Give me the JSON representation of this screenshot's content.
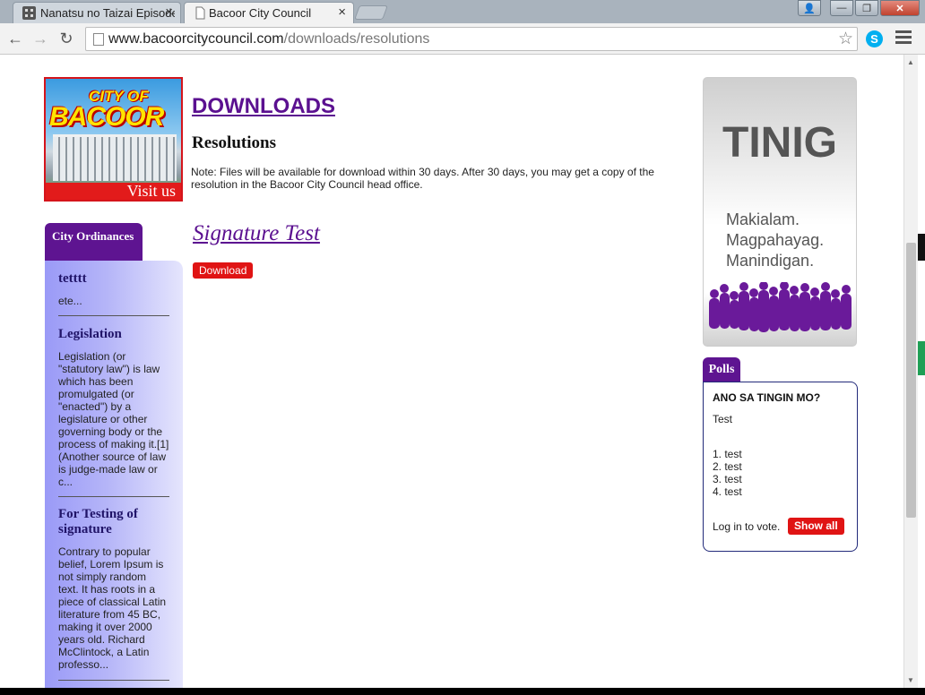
{
  "browser": {
    "tabs": [
      {
        "title": "Nanatsu no Taizai Episode",
        "close": "×"
      },
      {
        "title": "Bacoor City Council",
        "close": "×"
      }
    ],
    "url_host": "www.bacoorcitycouncil.com",
    "url_path": "/downloads/resolutions",
    "nav": {
      "back": "←",
      "forward": "→",
      "reload": "↻"
    },
    "star": "☆",
    "skype": "S",
    "window": {
      "minimize": "—",
      "maximize": "❐",
      "close": "✕",
      "user": "👤"
    }
  },
  "logo": {
    "line1": "CITY OF",
    "line2": "BACOOR",
    "visit": "Visit us"
  },
  "page": {
    "heading": "DOWNLOADS",
    "subheading": "Resolutions",
    "note": "Note: Files will be available for download within 30 days. After 30 days, you may get a copy of the resolution in the Bacoor City Council head office."
  },
  "documents": [
    {
      "title": "Signature Test",
      "button": "Download"
    }
  ],
  "ordinances": {
    "tab": "City Ordinances",
    "items": [
      {
        "title": "tetttt",
        "excerpt": "ete..."
      },
      {
        "title": "Legislation",
        "excerpt": "Legislation (or \"statutory law\") is law which has been promulgated (or \"enacted\") by a legislature or other governing body or the process of making it.[1] (Another source of law is judge-made law or c..."
      },
      {
        "title": "For Testing of signature",
        "excerpt": "Contrary to popular belief, Lorem Ipsum is not simply random text. It has roots in a piece of classical Latin literature from 45 BC, making it over 2000 years old. Richard McClintock, a Latin professo..."
      }
    ]
  },
  "tinig": {
    "title": "TINIG",
    "lines": [
      "Makialam.",
      "Magpahayag.",
      "Manindigan."
    ]
  },
  "polls": {
    "tab": "Polls",
    "question": "ANO SA TINGIN MO?",
    "description": "Test",
    "options": [
      "1. test",
      "2. test",
      "3. test",
      "4. test"
    ],
    "login_text": "Log in to vote.",
    "show_all": "Show all"
  },
  "colors": {
    "accent_purple": "#5e1491",
    "link_purple": "#5b1090",
    "button_red": "#e01414"
  }
}
